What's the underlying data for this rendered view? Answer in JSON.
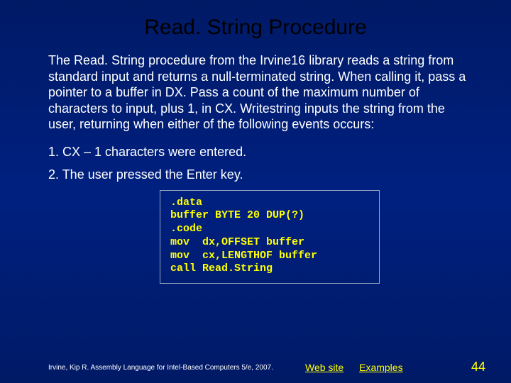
{
  "title": "Read. String Procedure",
  "paragraph": "The Read. String procedure from the Irvine16 library reads a string from standard input and returns a null-terminated string. When calling it, pass a pointer to a buffer in DX. Pass a count of the maximum number of characters to input, plus 1, in CX. Writestring inputs the string from the user, returning when either of the following events occurs:",
  "item1": "1. CX – 1 characters were entered.",
  "item2": "2. The user pressed the Enter key.",
  "code": {
    "l1": ".data",
    "l2": "buffer BYTE 20 DUP(?)",
    "l3": ".code",
    "l4": "mov  dx,OFFSET buffer",
    "l5": "mov  cx,LENGTHOF buffer",
    "l6": "call Read.String"
  },
  "citation": "Irvine, Kip R. Assembly Language for Intel-Based Computers 5/e, 2007.",
  "link1": "Web site",
  "link2": "Examples",
  "pagenum": "44"
}
